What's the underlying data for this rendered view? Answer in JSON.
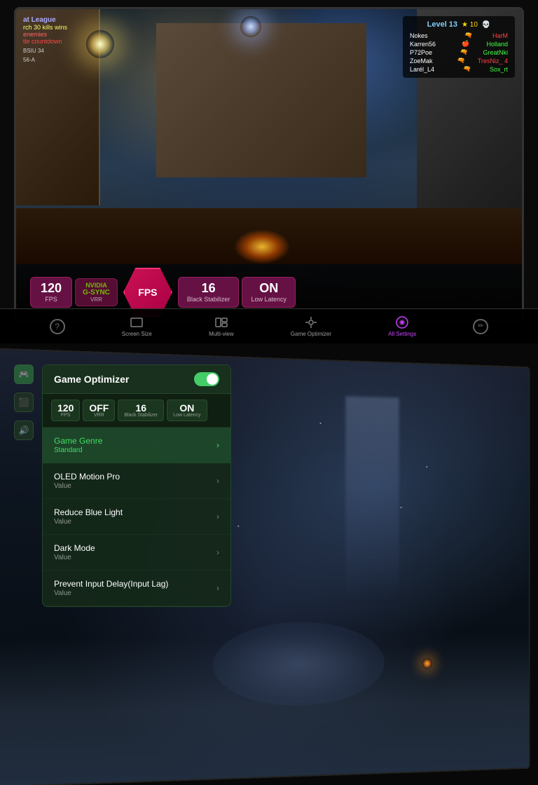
{
  "top": {
    "hud": {
      "level": "Level 13",
      "stars": "★ 10",
      "skull": "💀",
      "players": [
        {
          "name": "Nokes",
          "gun": "🔫",
          "team1": "HarM",
          "team2": ""
        },
        {
          "name": "Karren56",
          "gun": "🍎",
          "team1": "Holland",
          "team2": ""
        },
        {
          "name": "P72Poe",
          "gun": "🔫",
          "team1": "GreatNki",
          "team2": ""
        },
        {
          "name": "ZoeMak",
          "gun": "🔫",
          "team1": "TresNiz_",
          "team2": "4"
        },
        {
          "name": "LarélL4",
          "gun": "🔫",
          "team1": "Sox_rt",
          "team2": ""
        }
      ]
    },
    "left_hud": {
      "title": "at League",
      "kills": "rch 30 kills wins",
      "enemies": "enemies",
      "countdown": "tle countdown",
      "score1": "BSIU  34",
      "score2": "56-A"
    },
    "stats": {
      "fps_value": "120",
      "fps_label": "FPS",
      "gsync_brand": "NVIDIA",
      "gsync_name": "G-SYNC",
      "gsync_sub": "VRR",
      "center_label": "FPS",
      "black_value": "16",
      "black_label": "Black Stabilizer",
      "latency_value": "ON",
      "latency_label": "Low Latency"
    },
    "nav": {
      "help_label": "",
      "screen_size_label": "Screen Size",
      "multiview_label": "Multi-view",
      "optimizer_label": "Game Optimizer",
      "settings_label": "All Settings",
      "edit_label": ""
    }
  },
  "bottom": {
    "optimizer": {
      "title": "Game Optimizer",
      "toggle_state": "on",
      "stats": {
        "fps": {
          "value": "120",
          "label": "FPS"
        },
        "vrr": {
          "value": "OFF",
          "label": "VRR"
        },
        "black": {
          "value": "16",
          "label": "Black Stabilizer"
        },
        "latency": {
          "value": "ON",
          "label": "Low Latency"
        }
      },
      "menu_items": [
        {
          "title": "Game Genre",
          "value": "Standard",
          "active": true
        },
        {
          "title": "OLED Motion Pro",
          "value": "Value",
          "active": false
        },
        {
          "title": "Reduce Blue Light",
          "value": "Value",
          "active": false
        },
        {
          "title": "Dark Mode",
          "value": "Value",
          "active": false
        },
        {
          "title": "Prevent Input Delay(Input Lag)",
          "value": "Value",
          "active": false
        }
      ]
    },
    "side_rail": {
      "icons": [
        {
          "name": "gamepad-icon",
          "symbol": "🎮",
          "active": true
        },
        {
          "name": "screen-icon",
          "symbol": "⬛",
          "active": false
        },
        {
          "name": "volume-icon",
          "symbol": "🔊",
          "active": false
        }
      ]
    }
  }
}
